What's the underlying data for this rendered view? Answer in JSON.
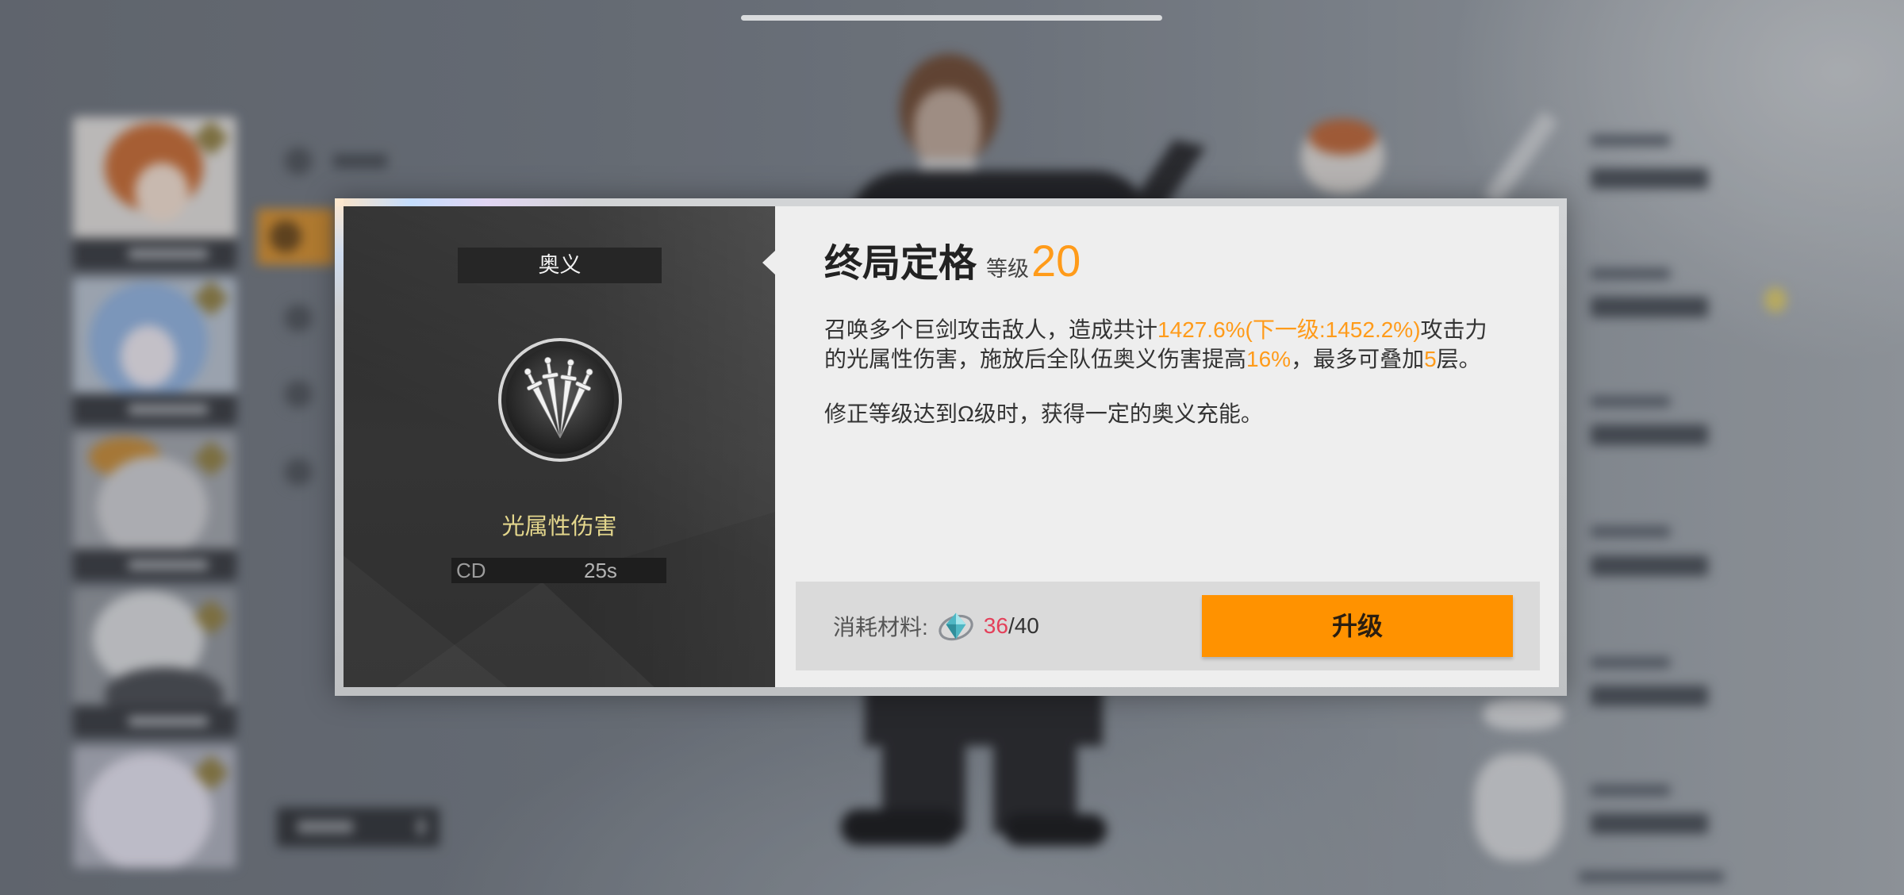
{
  "dialog": {
    "category_label": "奥义",
    "skill_icon": "swords-fan-icon",
    "element_label": "光属性伤害",
    "cooldown": {
      "label": "CD",
      "value": "25s"
    },
    "title": "终局定格",
    "level": {
      "label": "等级",
      "value": "20"
    },
    "description": {
      "line1": [
        "召唤多个巨剑攻击敌人，造成共计",
        "1427.6%(下一级:1452.2%)",
        "攻击力"
      ],
      "line2": [
        "的光属性伤害，施放后全队伍奥义伤害提高",
        "16%",
        "，最多可叠加",
        "5",
        "层。"
      ]
    },
    "note": "修正等级达到Ω级时，获得一定的奥义充能。",
    "cost": {
      "label": "消耗材料:",
      "icon": "crystal-material-icon",
      "owned": "36",
      "separator": "/",
      "required": "40"
    },
    "upgrade_button": {
      "label": "升级"
    }
  },
  "colors": {
    "highlight": "#ff9b1a",
    "insufficient": "#e4405a",
    "upgrade_button": "#ff9200",
    "element_text": "#e3d68c"
  }
}
